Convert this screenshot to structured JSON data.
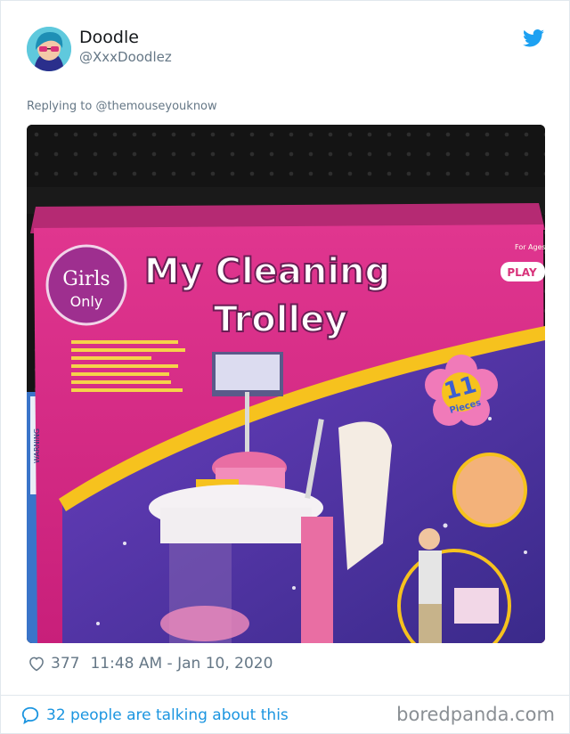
{
  "tweet": {
    "display_name": "Doodle",
    "handle": "@XxxDoodlez",
    "reply_prefix": "Replying to",
    "reply_to": "@themouseyouknow",
    "likes": "377",
    "timestamp": "11:48 AM - Jan 10, 2020",
    "talking": "32 people are talking about this"
  },
  "photo": {
    "box_title_line1": "My Cleaning",
    "box_title_line2": "Trolley",
    "brand_line1": "Girls",
    "brand_line2": "Only",
    "pieces_count": "11",
    "pieces_label": "Pieces",
    "play_badge": "PLAY",
    "for_ages": "For Ages",
    "side_label": "WARNING"
  },
  "watermark": "boredpanda.com",
  "colors": {
    "link_blue": "#1b95e0",
    "muted": "#657786",
    "twitter_blue": "#1da1f2"
  },
  "icons": [
    "twitter-bird-icon",
    "heart-icon",
    "speech-bubble-icon"
  ]
}
